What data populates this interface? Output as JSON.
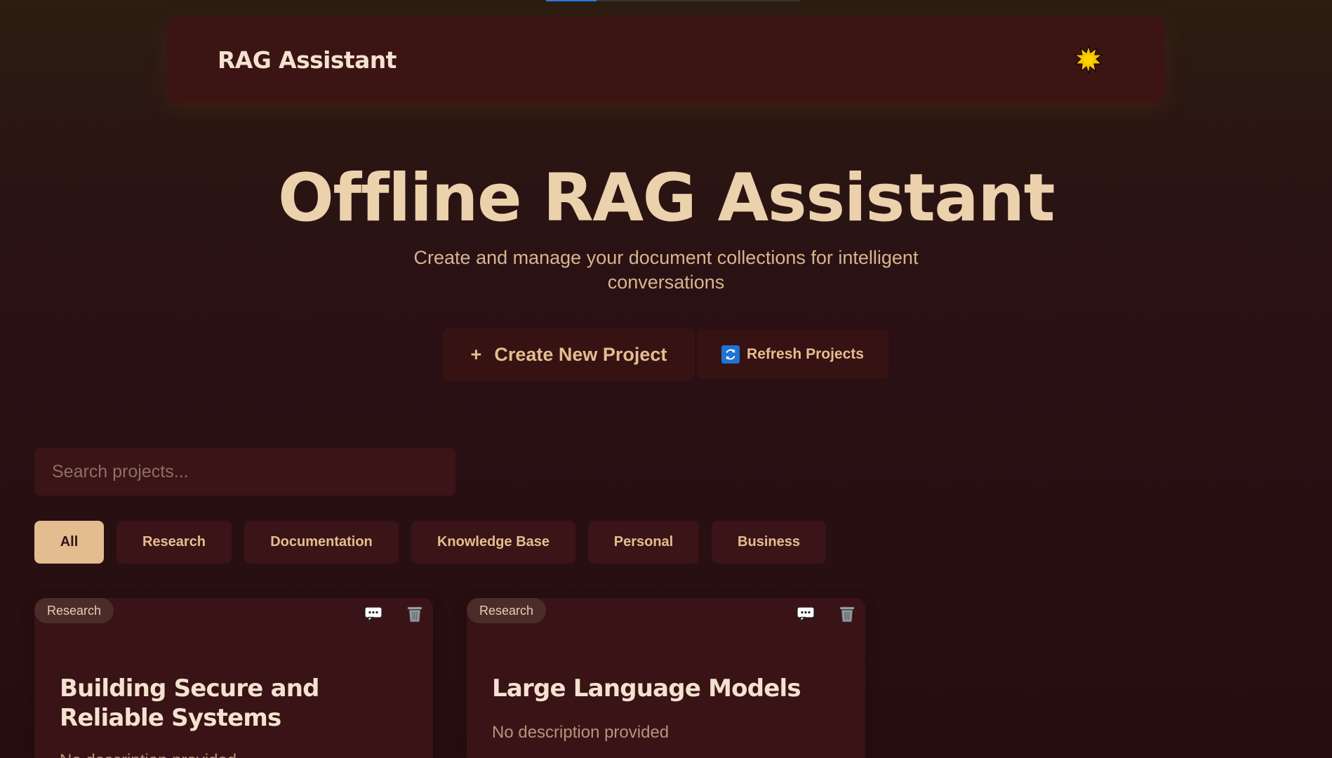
{
  "header": {
    "logo": "RAG Assistant",
    "theme_toggle_icon": "sun-icon"
  },
  "hero": {
    "title": "Offline RAG Assistant",
    "subtitle": "Create and manage your document collections for intelligent conversations"
  },
  "actions": {
    "create_icon": "+",
    "create_label": "Create New Project",
    "refresh_icon": "refresh-icon",
    "refresh_label": "Refresh Projects"
  },
  "search": {
    "placeholder": "Search projects...",
    "value": ""
  },
  "filters": [
    {
      "label": "All",
      "active": true
    },
    {
      "label": "Research",
      "active": false
    },
    {
      "label": "Documentation",
      "active": false
    },
    {
      "label": "Knowledge Base",
      "active": false
    },
    {
      "label": "Personal",
      "active": false
    },
    {
      "label": "Business",
      "active": false
    }
  ],
  "projects": [
    {
      "tag": "Research",
      "title": "Building Secure and Reliable Systems",
      "description": "No description provided",
      "icons": [
        "chat-icon",
        "trash-icon"
      ]
    },
    {
      "tag": "Research",
      "title": "Large Language Models",
      "description": "No description provided",
      "icons": [
        "chat-icon",
        "trash-icon"
      ]
    }
  ],
  "colors": {
    "accent": "#e3bd8f",
    "header_bg": "#3b1413",
    "card_bg": "#3a1316",
    "title": "#ecd1ad",
    "progress": "#2b79d6"
  }
}
